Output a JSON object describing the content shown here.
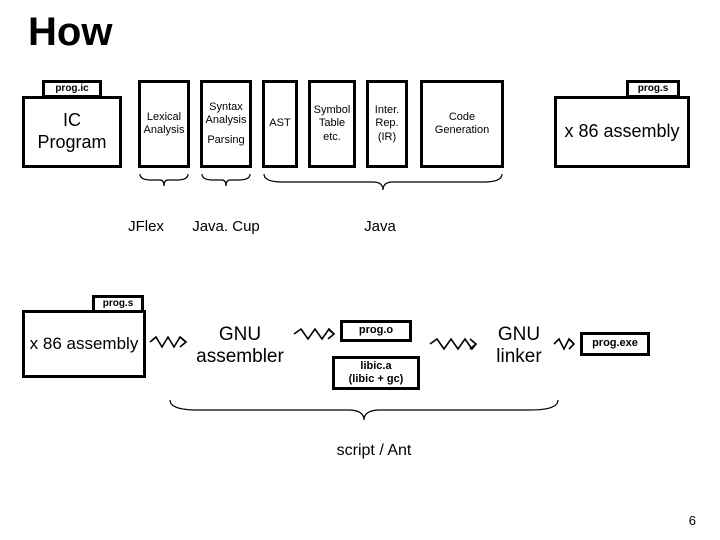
{
  "title": "How",
  "row1": {
    "prog_ic": "prog.ic",
    "ic_program": "IC\nProgram",
    "lexical": "Lexical\nAnalysis",
    "syntax": "Syntax\nAnalysis",
    "parsing": "Parsing",
    "ast": "AST",
    "symbol": "Symbol\nTable\netc.",
    "inter": "Inter.\nRep.\n(IR)",
    "codegen": "Code\nGeneration",
    "prog_s": "prog.s",
    "x86": "x 86 assembly"
  },
  "groups": {
    "jflex": "JFlex",
    "javacup": "Java. Cup",
    "java": "Java"
  },
  "row2": {
    "prog_s": "prog.s",
    "x86": "x 86 assembly",
    "gnu_asm": "GNU\nassembler",
    "prog_o": "prog.o",
    "libic": "libic.a\n(libic + gc)",
    "gnu_linker": "GNU\nlinker",
    "prog_exe": "prog.exe"
  },
  "script_ant": "script / Ant",
  "slide_number": "6"
}
